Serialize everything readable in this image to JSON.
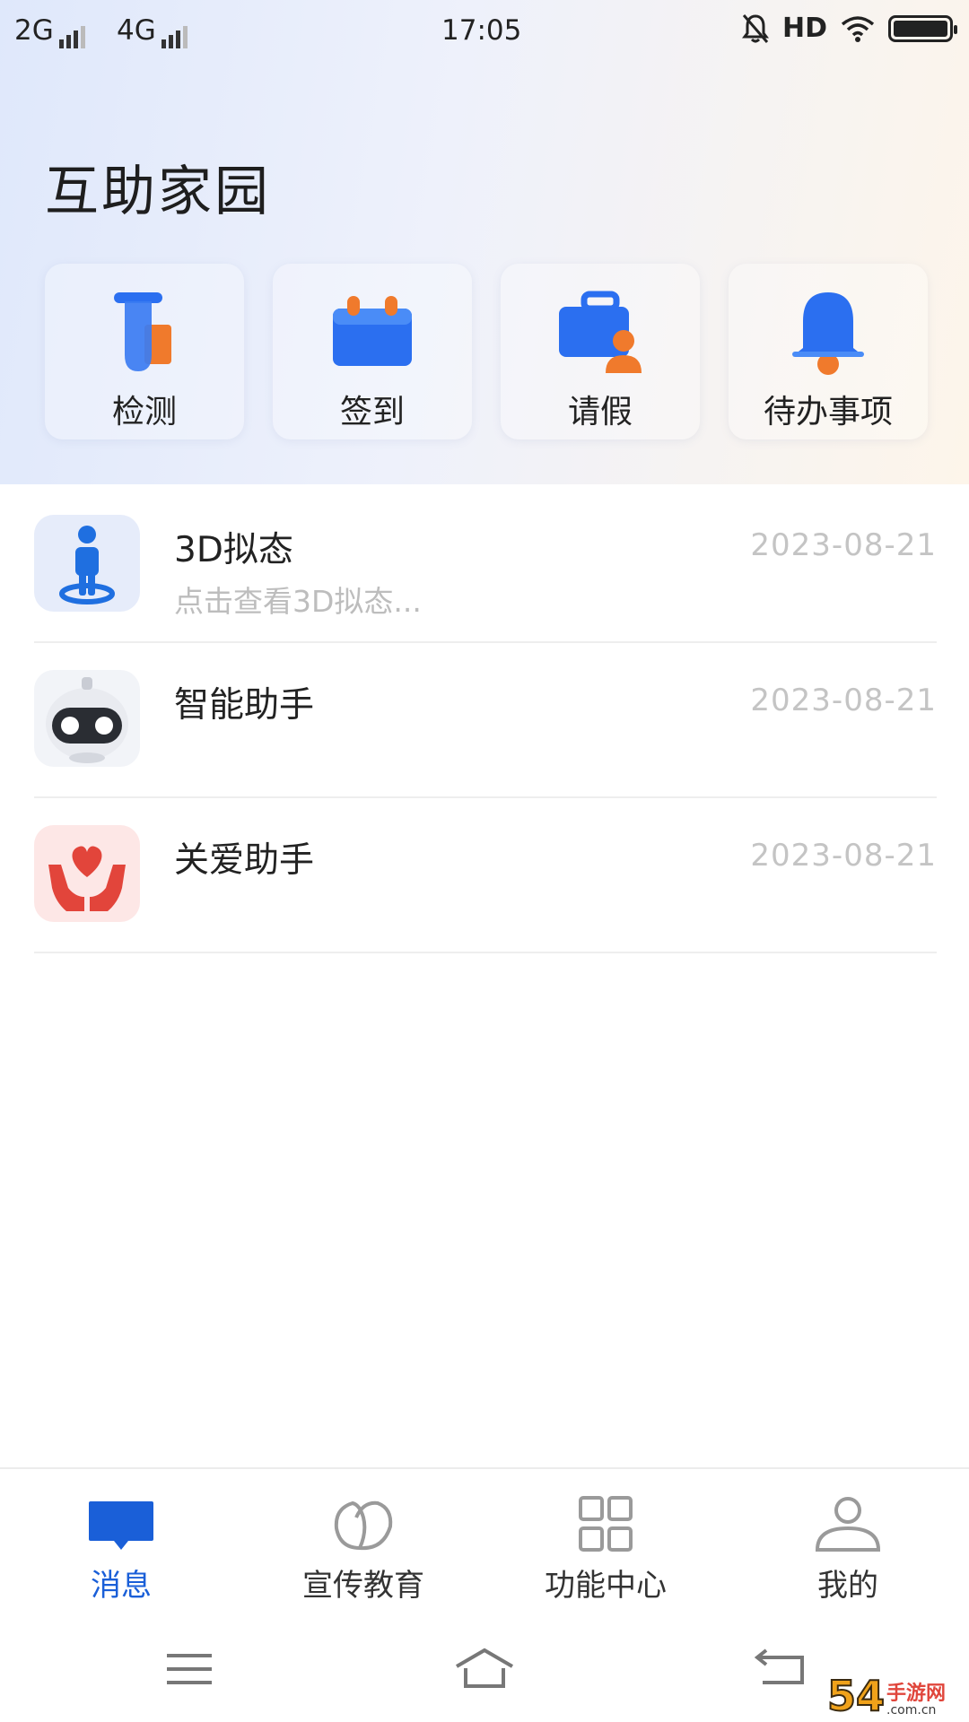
{
  "status_bar": {
    "net1": "2G",
    "net2": "4G",
    "time": "17:05",
    "hd": "HD"
  },
  "page_title": "互助家园",
  "quick_actions": [
    {
      "label": "检测",
      "icon": "test-tube-icon"
    },
    {
      "label": "签到",
      "icon": "calendar-icon"
    },
    {
      "label": "请假",
      "icon": "briefcase-person-icon"
    },
    {
      "label": "待办事项",
      "icon": "bell-icon"
    }
  ],
  "messages": [
    {
      "name": "3D拟态",
      "preview": "点击查看3D拟态...",
      "date": "2023-08-21",
      "icon": "3d-person-icon"
    },
    {
      "name": "智能助手",
      "preview": "",
      "date": "2023-08-21",
      "icon": "robot-icon"
    },
    {
      "name": "关爱助手",
      "preview": "",
      "date": "2023-08-21",
      "icon": "heart-hands-icon"
    }
  ],
  "tabs": [
    {
      "label": "消息",
      "icon": "message-icon",
      "active": true
    },
    {
      "label": "宣传教育",
      "icon": "leaf-icon",
      "active": false
    },
    {
      "label": "功能中心",
      "icon": "grid-icon",
      "active": false
    },
    {
      "label": "我的",
      "icon": "user-icon",
      "active": false
    }
  ],
  "watermark": {
    "brand": "54",
    "site": "手游网",
    "domain": ".com.cn"
  },
  "colors": {
    "accent": "#1a5fd8",
    "icon_blue": "#2b6ff0",
    "icon_orange": "#f07a2c",
    "heart_red": "#e2453b"
  }
}
